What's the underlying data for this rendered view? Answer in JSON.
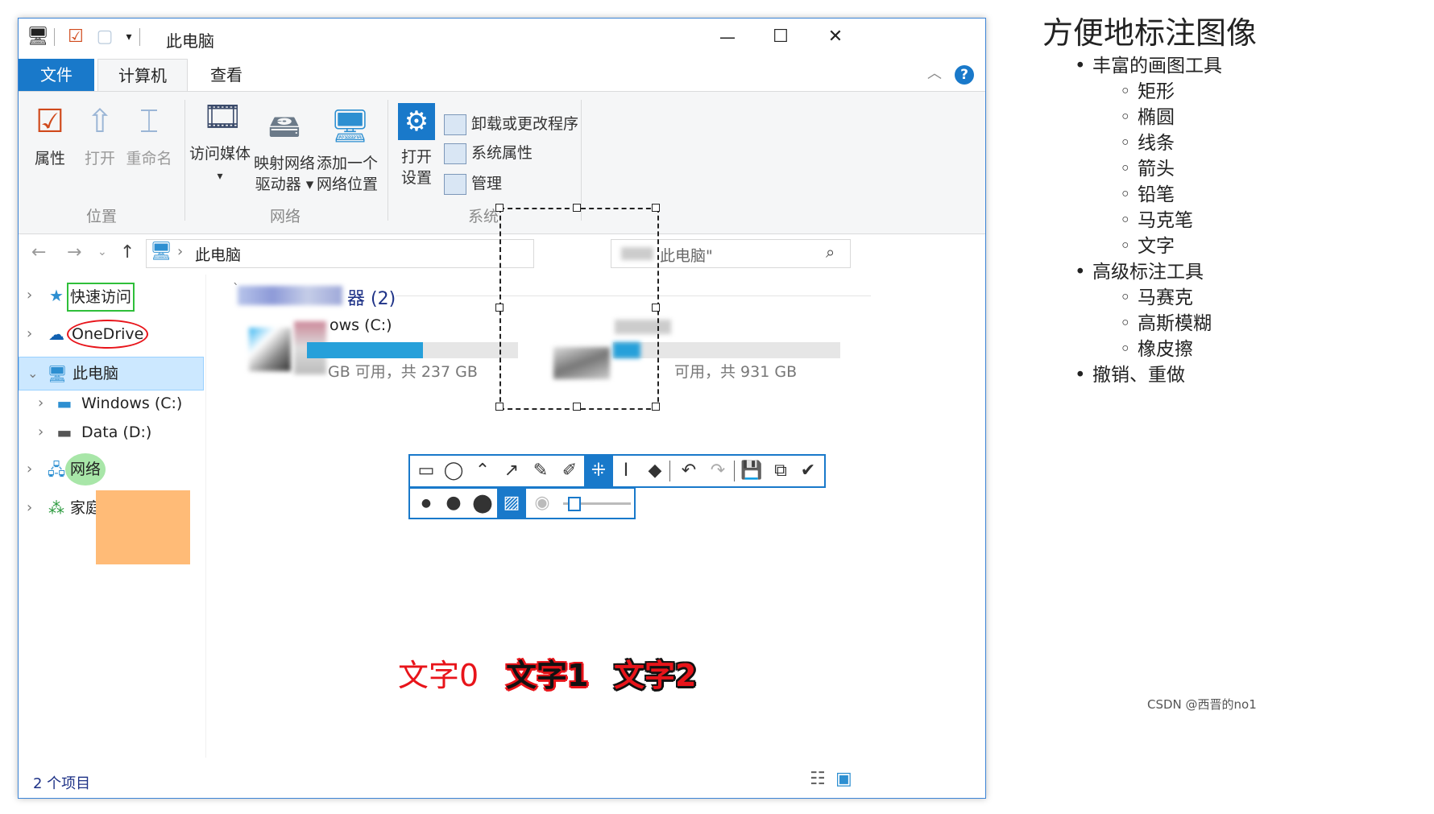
{
  "window": {
    "title": "此电脑",
    "controls": {
      "minimize": "—",
      "maximize": "☐",
      "close": "✕"
    }
  },
  "tabs": [
    {
      "label": "文件"
    },
    {
      "label": "计算机"
    },
    {
      "label": "查看"
    }
  ],
  "help_icon": "?",
  "ribbon": {
    "groups": [
      {
        "label": "位置",
        "buttons": [
          "属性",
          "打开",
          "重命名"
        ]
      },
      {
        "label": "网络",
        "buttons": [
          {
            "line1": "访问媒体",
            "line2": ""
          },
          {
            "line1": "映射网络",
            "line2": "驱动器 ▾"
          },
          {
            "line1": "添加一个",
            "line2": "网络位置"
          }
        ]
      },
      {
        "label": "系统",
        "open_settings": {
          "line1": "打开",
          "line2": "设置"
        },
        "small": [
          "卸载或更改程序",
          "系统属性",
          "管理"
        ]
      }
    ]
  },
  "address": {
    "crumb": "此电脑",
    "search_placeholder": "此电脑\""
  },
  "nav": {
    "items": [
      {
        "label": "快速访问",
        "icon": "pin-icon"
      },
      {
        "label": "OneDrive",
        "icon": "cloud-icon"
      },
      {
        "label": "此电脑",
        "icon": "computer-icon"
      },
      {
        "label": "Windows (C:)",
        "icon": "drive-icon"
      },
      {
        "label": "Data (D:)",
        "icon": "drive-icon"
      },
      {
        "label": "网络",
        "icon": "network-icon"
      },
      {
        "label": "家庭组",
        "icon": "homegroup-icon"
      }
    ]
  },
  "content": {
    "group_header": "器 (2)",
    "drive_c": {
      "name": "ows (C:)",
      "space": "GB 可用，共 237 GB",
      "used_fraction": 0.55
    },
    "drive_d": {
      "space": "可用，共 931 GB",
      "used_fraction": 0.12
    }
  },
  "status": {
    "count": "2 个项目"
  },
  "annotations": {
    "text0": "文字0",
    "text1": "文字1",
    "text2": "文字2",
    "red": "#e8141a",
    "green": "#2fbf3a",
    "orange": "#ffbb77"
  },
  "right_panel": {
    "title": "方便地标注图像",
    "sections": [
      {
        "label": "丰富的画图工具",
        "items": [
          "矩形",
          "椭圆",
          "线条",
          "箭头",
          "铅笔",
          "马克笔",
          "文字"
        ]
      },
      {
        "label": "高级标注工具",
        "items": [
          "马赛克",
          "高斯模糊",
          "橡皮擦"
        ]
      },
      {
        "label": "撤销、重做",
        "items": []
      }
    ]
  },
  "watermark": "CSDN @西晋的no1"
}
